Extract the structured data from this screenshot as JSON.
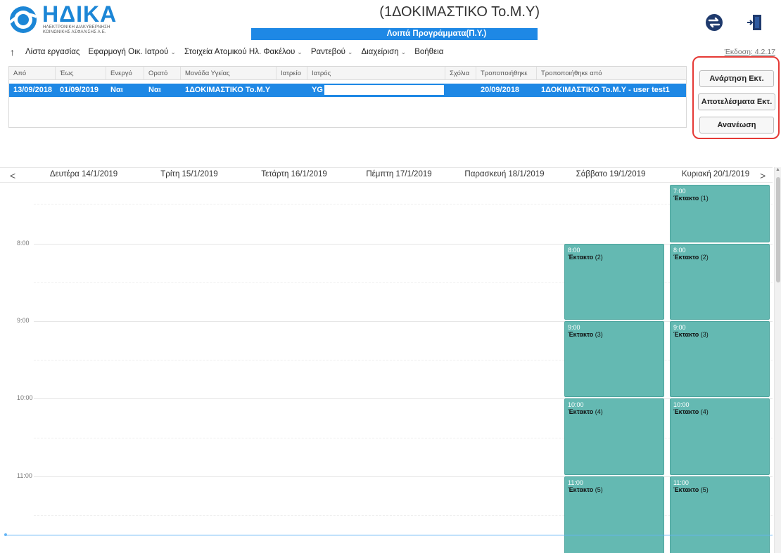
{
  "logo": {
    "title": "ΗΔΙΚΑ",
    "subtitle_line1": "ΗΛΕΚΤΡΟΝΙΚΗ ΔΙΑΚΥΒΕΡΝΗΣΗ",
    "subtitle_line2": "ΚΟΙΝΩΝΙΚΗΣ ΑΣΦΑΛΙΣΗΣ Α.Ε."
  },
  "header": {
    "org_title": "(1ΔΟΚΙΜΑΣΤΙΚΟ Το.Μ.Υ)",
    "subtitle": "Λοιπά Προγράμματα(Π.Υ.)",
    "swap_icon": "swap-circle-icon",
    "exit_icon": "exit-door-icon"
  },
  "menu": {
    "up_icon": "↑",
    "items": [
      {
        "label": "Λίστα εργασίας",
        "dropdown": false
      },
      {
        "label": "Εφαρμογή Οικ. Ιατρού",
        "dropdown": true
      },
      {
        "label": "Στοιχεία Ατομικού Ηλ. Φακέλου",
        "dropdown": true
      },
      {
        "label": "Ραντεβού",
        "dropdown": true
      },
      {
        "label": "Διαχείριση",
        "dropdown": true
      },
      {
        "label": "Βοήθεια",
        "dropdown": false
      }
    ],
    "version": "Έκδοση: 4.2.17"
  },
  "table": {
    "columns": [
      "Από",
      "Έως",
      "Ενεργό",
      "Ορατό",
      "Μονάδα Υγείας",
      "Ιατρείο",
      "Ιατρός",
      "Σχόλια",
      "Τροποποιήθηκε",
      "Τροποποιήθηκε από"
    ],
    "rows": [
      [
        "13/09/2018",
        "01/09/2019",
        "Ναι",
        "Ναι",
        "1ΔΟΚΙΜΑΣΤΙΚΟ Το.Μ.Υ",
        "",
        "YG",
        "",
        "20/09/2018",
        "1ΔΟΚΙΜΑΣΤΙΚΟ Το.Μ.Υ - user test1"
      ]
    ]
  },
  "buttons": {
    "publish": "Ανάρτηση Εκτ.",
    "results": "Αποτελέσματα Εκτ.",
    "refresh": "Ανανέωση"
  },
  "calendar": {
    "prev": "<",
    "next": ">",
    "days": [
      "Δευτέρα 14/1/2019",
      "Τρίτη 15/1/2019",
      "Τετάρτη 16/1/2019",
      "Πέμπτη 17/1/2019",
      "Παρασκευή 18/1/2019",
      "Σάββατο 19/1/2019",
      "Κυριακή 20/1/2019"
    ],
    "times": [
      "8:00",
      "9:00",
      "10:00",
      "11:00"
    ],
    "events": {
      "sun_7": {
        "time": "7:00",
        "title": "Έκτακτο",
        "count": "(1)"
      },
      "sat_8": {
        "time": "8:00",
        "title": "Έκτακτο",
        "count": "(2)"
      },
      "sun_8": {
        "time": "8:00",
        "title": "Έκτακτο",
        "count": "(2)"
      },
      "sat_9": {
        "time": "9:00",
        "title": "Έκτακτο",
        "count": "(3)"
      },
      "sun_9": {
        "time": "9:00",
        "title": "Έκτακτο",
        "count": "(3)"
      },
      "sat_10": {
        "time": "10:00",
        "title": "Έκτακτο",
        "count": "(4)"
      },
      "sun_10": {
        "time": "10:00",
        "title": "Έκτακτο",
        "count": "(4)"
      },
      "sat_11": {
        "time": "11:00",
        "title": "Έκτακτο",
        "count": "(5)"
      },
      "sun_11": {
        "time": "11:00",
        "title": "Έκτακτο",
        "count": "(5)"
      }
    }
  }
}
